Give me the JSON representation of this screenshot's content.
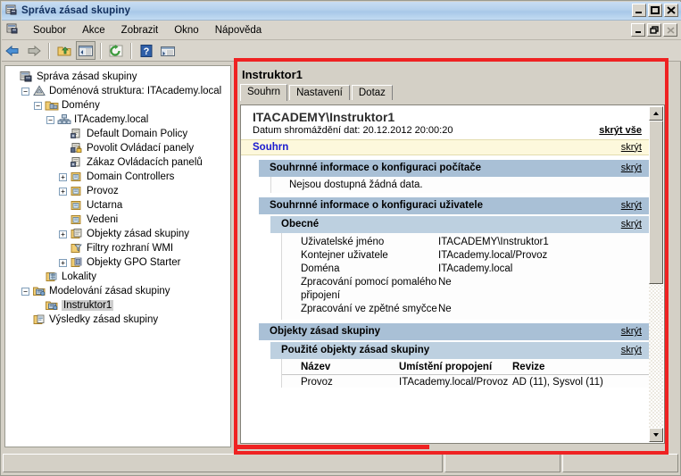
{
  "window": {
    "title": "Správa zásad skupiny",
    "icon": "gpmc-console-icon",
    "buttons": {
      "minimize": "_",
      "maximize": "☐",
      "close": "✕"
    }
  },
  "menubar": {
    "icon": "gpmc-console-icon",
    "items": [
      {
        "label": "Soubor",
        "name": "menu-soubor"
      },
      {
        "label": "Akce",
        "name": "menu-akce"
      },
      {
        "label": "Zobrazit",
        "name": "menu-zobrazit"
      },
      {
        "label": "Okno",
        "name": "menu-okno"
      },
      {
        "label": "Nápověda",
        "name": "menu-napoveda"
      }
    ],
    "mdi_buttons": {
      "minimize": "_",
      "restore": "❐",
      "close": "✕"
    }
  },
  "toolbar": {
    "buttons": [
      {
        "name": "back-button",
        "icon": "back-arrow-icon",
        "pressed": false
      },
      {
        "name": "forward-button",
        "icon": "forward-arrow-icon",
        "pressed": false
      },
      {
        "name": "up-folder-button",
        "icon": "folder-up-icon",
        "pressed": false
      },
      {
        "name": "show-hide-tree-button",
        "icon": "console-tree-icon",
        "pressed": true
      },
      {
        "name": "refresh-button",
        "icon": "refresh-icon",
        "pressed": false
      },
      {
        "name": "help-button",
        "icon": "question-mark-icon",
        "pressed": false
      },
      {
        "name": "export-list-button",
        "icon": "export-list-icon",
        "pressed": false
      }
    ]
  },
  "tree": {
    "nodes": [
      {
        "label": "Správa zásad skupiny",
        "indent": 0,
        "expander": "",
        "icon": "gpmc-console-icon",
        "selected": false
      },
      {
        "label": "Doménová struktura: ITAcademy.local",
        "indent": 1,
        "expander": "−",
        "icon": "forest-icon",
        "selected": false
      },
      {
        "label": "Domény",
        "indent": 2,
        "expander": "−",
        "icon": "domains-icon",
        "selected": false
      },
      {
        "label": "ITAcademy.local",
        "indent": 3,
        "expander": "−",
        "icon": "domain-icon",
        "selected": false
      },
      {
        "label": "Default Domain Policy",
        "indent": 4,
        "expander": "",
        "icon": "gpo-link-icon",
        "selected": false
      },
      {
        "label": "Povolit Ovládací panely",
        "indent": 4,
        "expander": "",
        "icon": "gpo-link-locked-icon",
        "selected": false
      },
      {
        "label": "Zákaz Ovládacích panelů",
        "indent": 4,
        "expander": "",
        "icon": "gpo-link-icon",
        "selected": false
      },
      {
        "label": "Domain Controllers",
        "indent": 4,
        "expander": "+",
        "icon": "ou-icon",
        "selected": false
      },
      {
        "label": "Provoz",
        "indent": 4,
        "expander": "+",
        "icon": "ou-icon",
        "selected": false
      },
      {
        "label": "Uctarna",
        "indent": 4,
        "expander": "",
        "icon": "ou-icon",
        "selected": false
      },
      {
        "label": "Vedeni",
        "indent": 4,
        "expander": "",
        "icon": "ou-icon",
        "selected": false
      },
      {
        "label": "Objekty zásad skupiny",
        "indent": 4,
        "expander": "+",
        "icon": "gpo-container-icon",
        "selected": false
      },
      {
        "label": "Filtry rozhraní WMI",
        "indent": 4,
        "expander": "",
        "icon": "wmi-filter-icon",
        "selected": false
      },
      {
        "label": "Objekty GPO Starter",
        "indent": 4,
        "expander": "+",
        "icon": "starter-gpo-icon",
        "selected": false
      },
      {
        "label": "Lokality",
        "indent": 2,
        "expander": "",
        "icon": "sites-icon",
        "selected": false
      },
      {
        "label": "Modelování zásad skupiny",
        "indent": 1,
        "expander": "−",
        "icon": "modeling-icon",
        "selected": false
      },
      {
        "label": "Instruktor1",
        "indent": 2,
        "expander": "",
        "icon": "modeling-query-icon",
        "selected": true
      },
      {
        "label": "Výsledky zásad skupiny",
        "indent": 1,
        "expander": "",
        "icon": "results-icon",
        "selected": false
      }
    ]
  },
  "content": {
    "title": "Instruktor1",
    "tabs": [
      {
        "label": "Souhrn",
        "name": "tab-souhrn",
        "active": true
      },
      {
        "label": "Nastavení",
        "name": "tab-nastaveni",
        "active": false
      },
      {
        "label": "Dotaz",
        "name": "tab-dotaz",
        "active": false
      }
    ],
    "report": {
      "heading": "ITACADEMY\\Instruktor1",
      "subtitle": "Datum shromáždění dat: 20.12.2012 20:00:20",
      "hide_all_link": "skrýt vše",
      "hide_link": "skrýt",
      "summary_band": "Souhrn",
      "computer_section": {
        "title": "Souhrnné informace o konfiguraci počítače",
        "no_data": "Nejsou dostupná žádná data."
      },
      "user_section": {
        "title": "Souhrnné informace o konfiguraci uživatele",
        "general": {
          "title": "Obecné",
          "rows": [
            {
              "key": "Uživatelské jméno",
              "value": "ITACADEMY\\Instruktor1"
            },
            {
              "key": "Kontejner uživatele",
              "value": "ITAcademy.local/Provoz"
            },
            {
              "key": "Doména",
              "value": "ITAcademy.local"
            },
            {
              "key": "Zpracování pomocí pomalého připojení",
              "value": "Ne"
            },
            {
              "key": "Zpracování ve zpětné smyčce",
              "value": "Ne"
            }
          ]
        },
        "gpo_section": {
          "title": "Objekty zásad skupiny",
          "applied": {
            "title": "Použité objekty zásad skupiny",
            "columns": [
              "Název",
              "Umístění propojení",
              "Revize"
            ],
            "rows": [
              [
                "Provoz",
                "ITAcademy.local/Provoz",
                "AD (11), Sysvol (11)"
              ]
            ]
          }
        }
      }
    },
    "scrollbar": {
      "up": "▲",
      "down": "▼"
    }
  },
  "statusbar": {
    "panes": [
      "",
      "",
      ""
    ]
  },
  "colors": {
    "titlebar_text": "#13305e",
    "band_level1": "#a9c0d6",
    "band_level2": "#bdd0e0",
    "summary_band": "#fdf8dc",
    "summary_text": "#1a1ad0",
    "annotation_red": "#ef2222",
    "window_bg": "#d4d0c6"
  }
}
